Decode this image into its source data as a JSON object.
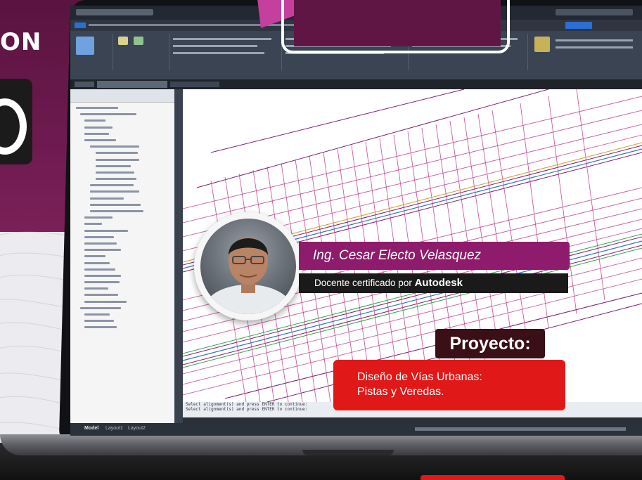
{
  "promo": {
    "title_fragment": "ON",
    "instructor_name": "Ing. Cesar Electo Velasquez",
    "certification_prefix": "Docente certificado por",
    "certification_brand": "Autodesk",
    "project_label": "Proyecto:",
    "project_description_line1": "Diseño de Vías Urbanas:",
    "project_description_line2": "Pistas y Veredas."
  },
  "colors": {
    "brand_purple": "#6d1a50",
    "banner_magenta": "#8f1b6c",
    "project_red": "#e01818",
    "project_label_dark": "#3a0f16"
  },
  "app": {
    "command_line_1": "Select alignment(s) and press ENTER to continue:",
    "command_line_2": "Select alignment(s) and press ENTER to continue:",
    "layout_tabs": [
      "Model",
      "Layout1",
      "Layout2"
    ]
  }
}
